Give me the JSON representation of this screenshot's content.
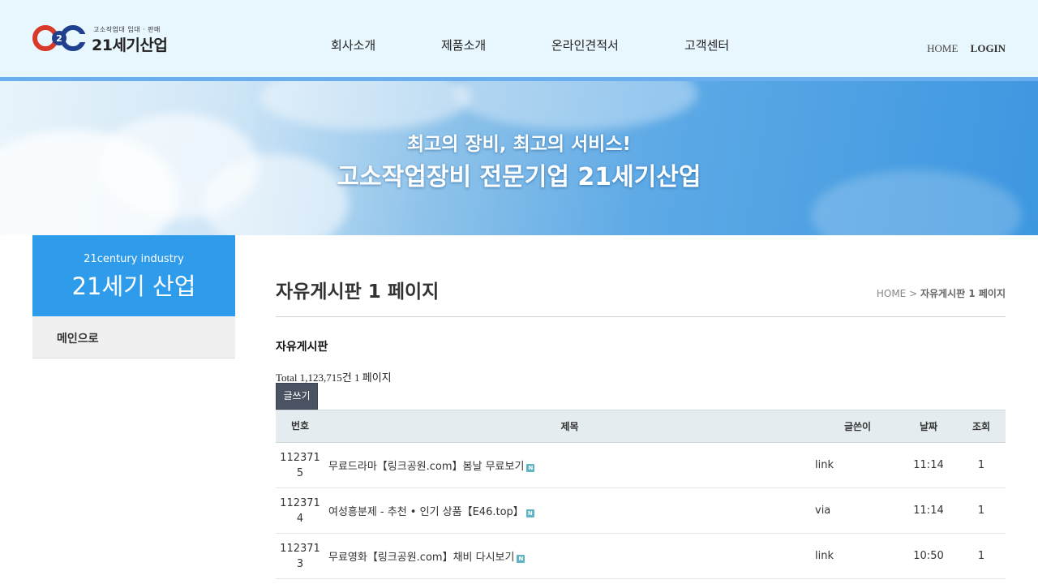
{
  "header": {
    "logo_small": "고소작업대 임대 · 판매",
    "logo_big": "21세기산업",
    "nav": [
      {
        "label": "회사소개"
      },
      {
        "label": "제품소개"
      },
      {
        "label": "온라인견적서"
      },
      {
        "label": "고객센터"
      }
    ],
    "home": "HOME",
    "login": "LOGIN"
  },
  "banner": {
    "sub": "최고의 장비, 최고의 서비스!",
    "main": "고소작업장비 전문기업 21세기산업"
  },
  "sidebar": {
    "small": "21century industry",
    "big": "21세기 산업",
    "item": "메인으로"
  },
  "content": {
    "page_title": "자유게시판 1 페이지",
    "breadcrumb_home": "HOME",
    "breadcrumb_current": "자유게시판 1 페이지",
    "board_name": "자유게시판",
    "total": "Total 1,123,715건 1 페이지",
    "write_label": "글쓰기",
    "columns": [
      "번호",
      "제목",
      "글쓴이",
      "날짜",
      "조회"
    ],
    "rows": [
      {
        "num_a": "112371",
        "num_b": "5",
        "subject": "무료드라마【링크공원.com】봄날 무료보기",
        "name": "link",
        "date": "11:14",
        "hit": "1"
      },
      {
        "num_a": "112371",
        "num_b": "4",
        "subject": "여성흥분제 - 추천 • 인기 상품【E46.top】",
        "name": "via",
        "date": "11:14",
        "hit": "1"
      },
      {
        "num_a": "112371",
        "num_b": "3",
        "subject": "무료영화【링크공원.com】채비 다시보기",
        "name": "link",
        "date": "10:50",
        "hit": "1"
      }
    ],
    "new_badge": "N"
  },
  "colors": {
    "header_bg": "#e8f6fe",
    "accent_blue": "#2f9ceb",
    "button_dark": "#4b5363"
  }
}
